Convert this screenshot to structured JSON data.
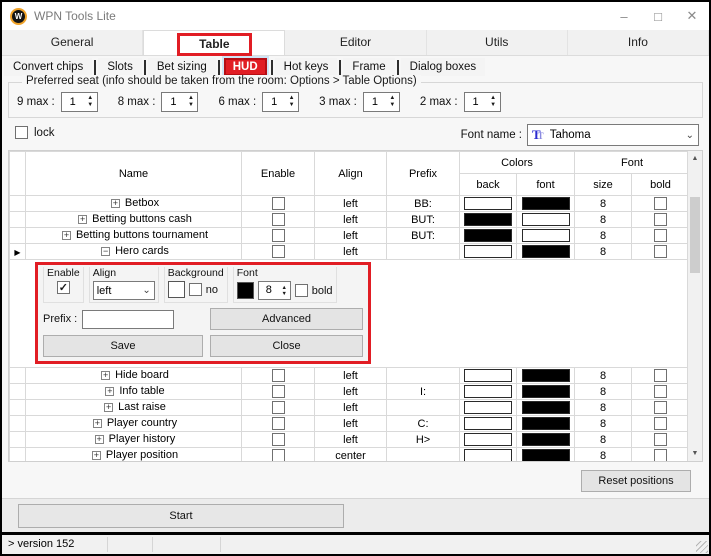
{
  "window": {
    "title": "WPN Tools Lite",
    "minimize_label": "–",
    "maximize_label": "□",
    "close_label": "✕",
    "icon_letter": "W"
  },
  "tabs": {
    "items": [
      {
        "label": "General",
        "selected": false
      },
      {
        "label": "Table",
        "selected": true,
        "highlighted": true
      },
      {
        "label": "Editor",
        "selected": false
      },
      {
        "label": "Utils",
        "selected": false
      },
      {
        "label": "Info",
        "selected": false
      }
    ]
  },
  "subtabs": {
    "items": [
      {
        "label": "Convert chips",
        "selected": false
      },
      {
        "label": "Slots",
        "selected": false
      },
      {
        "label": "Bet sizing",
        "selected": false
      },
      {
        "label": "HUD",
        "selected": true,
        "highlighted": true
      },
      {
        "label": "Hot keys",
        "selected": false
      },
      {
        "label": "Frame",
        "selected": false
      },
      {
        "label": "Dialog boxes",
        "selected": false
      }
    ]
  },
  "preferred_seat": {
    "title": "Preferred seat (info should be taken from the room: Options > Table Options)",
    "seats": [
      {
        "label": "9 max :",
        "value": "1"
      },
      {
        "label": "8 max :",
        "value": "1"
      },
      {
        "label": "6 max :",
        "value": "1"
      },
      {
        "label": "3 max :",
        "value": "1"
      },
      {
        "label": "2 max :",
        "value": "1"
      }
    ]
  },
  "lock": {
    "label": "lock",
    "checked": false
  },
  "font_selector": {
    "label": "Font name :",
    "value": "Tahoma"
  },
  "grid": {
    "headers": {
      "name": "Name",
      "enable": "Enable",
      "align": "Align",
      "prefix": "Prefix",
      "colors_group": "Colors",
      "back": "back",
      "font": "font",
      "font_group": "Font",
      "size": "size",
      "bold": "bold"
    },
    "rows": [
      {
        "name": "Betbox",
        "expander": "+",
        "enabled": false,
        "align": "left",
        "prefix": "BB:",
        "back_color": "#ffffff",
        "font_color": "#000000",
        "size": "8",
        "bold": false
      },
      {
        "name": "Betting buttons cash",
        "expander": "+",
        "enabled": false,
        "align": "left",
        "prefix": "BUT:",
        "back_color": "#000000",
        "font_color": "#ffffff",
        "size": "8",
        "bold": false
      },
      {
        "name": "Betting buttons tournament",
        "expander": "+",
        "enabled": false,
        "align": "left",
        "prefix": "BUT:",
        "back_color": "#000000",
        "font_color": "#ffffff",
        "size": "8",
        "bold": false
      },
      {
        "name": "Hero cards",
        "expander": "−",
        "enabled": false,
        "align": "left",
        "prefix": "",
        "back_color": "#ffffff",
        "font_color": "#000000",
        "size": "8",
        "bold": false,
        "selected": true,
        "expanded": true
      },
      {
        "name": "Hide board",
        "expander": "+",
        "enabled": false,
        "align": "left",
        "prefix": "",
        "back_color": "#ffffff",
        "font_color": "#000000",
        "size": "8",
        "bold": false
      },
      {
        "name": "Info table",
        "expander": "+",
        "enabled": false,
        "align": "left",
        "prefix": "I:",
        "back_color": "#ffffff",
        "font_color": "#000000",
        "size": "8",
        "bold": false
      },
      {
        "name": "Last raise",
        "expander": "+",
        "enabled": false,
        "align": "left",
        "prefix": "",
        "back_color": "#ffffff",
        "font_color": "#000000",
        "size": "8",
        "bold": false
      },
      {
        "name": "Player country",
        "expander": "+",
        "enabled": false,
        "align": "left",
        "prefix": "C:",
        "back_color": "#ffffff",
        "font_color": "#000000",
        "size": "8",
        "bold": false
      },
      {
        "name": "Player history",
        "expander": "+",
        "enabled": false,
        "align": "left",
        "prefix": "H>",
        "back_color": "#ffffff",
        "font_color": "#000000",
        "size": "8",
        "bold": false
      },
      {
        "name": "Player position",
        "expander": "+",
        "enabled": false,
        "align": "center",
        "prefix": "",
        "back_color": "#ffffff",
        "font_color": "#000000",
        "size": "8",
        "bold": false
      }
    ]
  },
  "editor_panel": {
    "enable_label": "Enable",
    "enable_checked": true,
    "align_label": "Align",
    "align_value": "left",
    "background_label": "Background",
    "background_no_label": "no",
    "font_label": "Font",
    "font_size": "8",
    "bold_label": "bold",
    "bold_checked": false,
    "prefix_label": "Prefix :",
    "prefix_value": "",
    "advanced_label": "Advanced",
    "save_label": "Save",
    "close_label": "Close"
  },
  "footer": {
    "reset_label": "Reset positions",
    "start_label": "Start"
  },
  "statusbar": {
    "text": "> version 152"
  },
  "icons": {
    "scroll_up": "▲",
    "scroll_down": "▼",
    "spinner_up": "▲",
    "spinner_down": "▼",
    "chevron_down": "⌄",
    "current_row_arrow": "▶",
    "check": "✓",
    "truetype": "T"
  },
  "colors": {
    "highlight_red": "#e11d24",
    "truetype_blue": "#2b2bd0",
    "swatch_black": "#000000",
    "swatch_white": "#ffffff"
  }
}
